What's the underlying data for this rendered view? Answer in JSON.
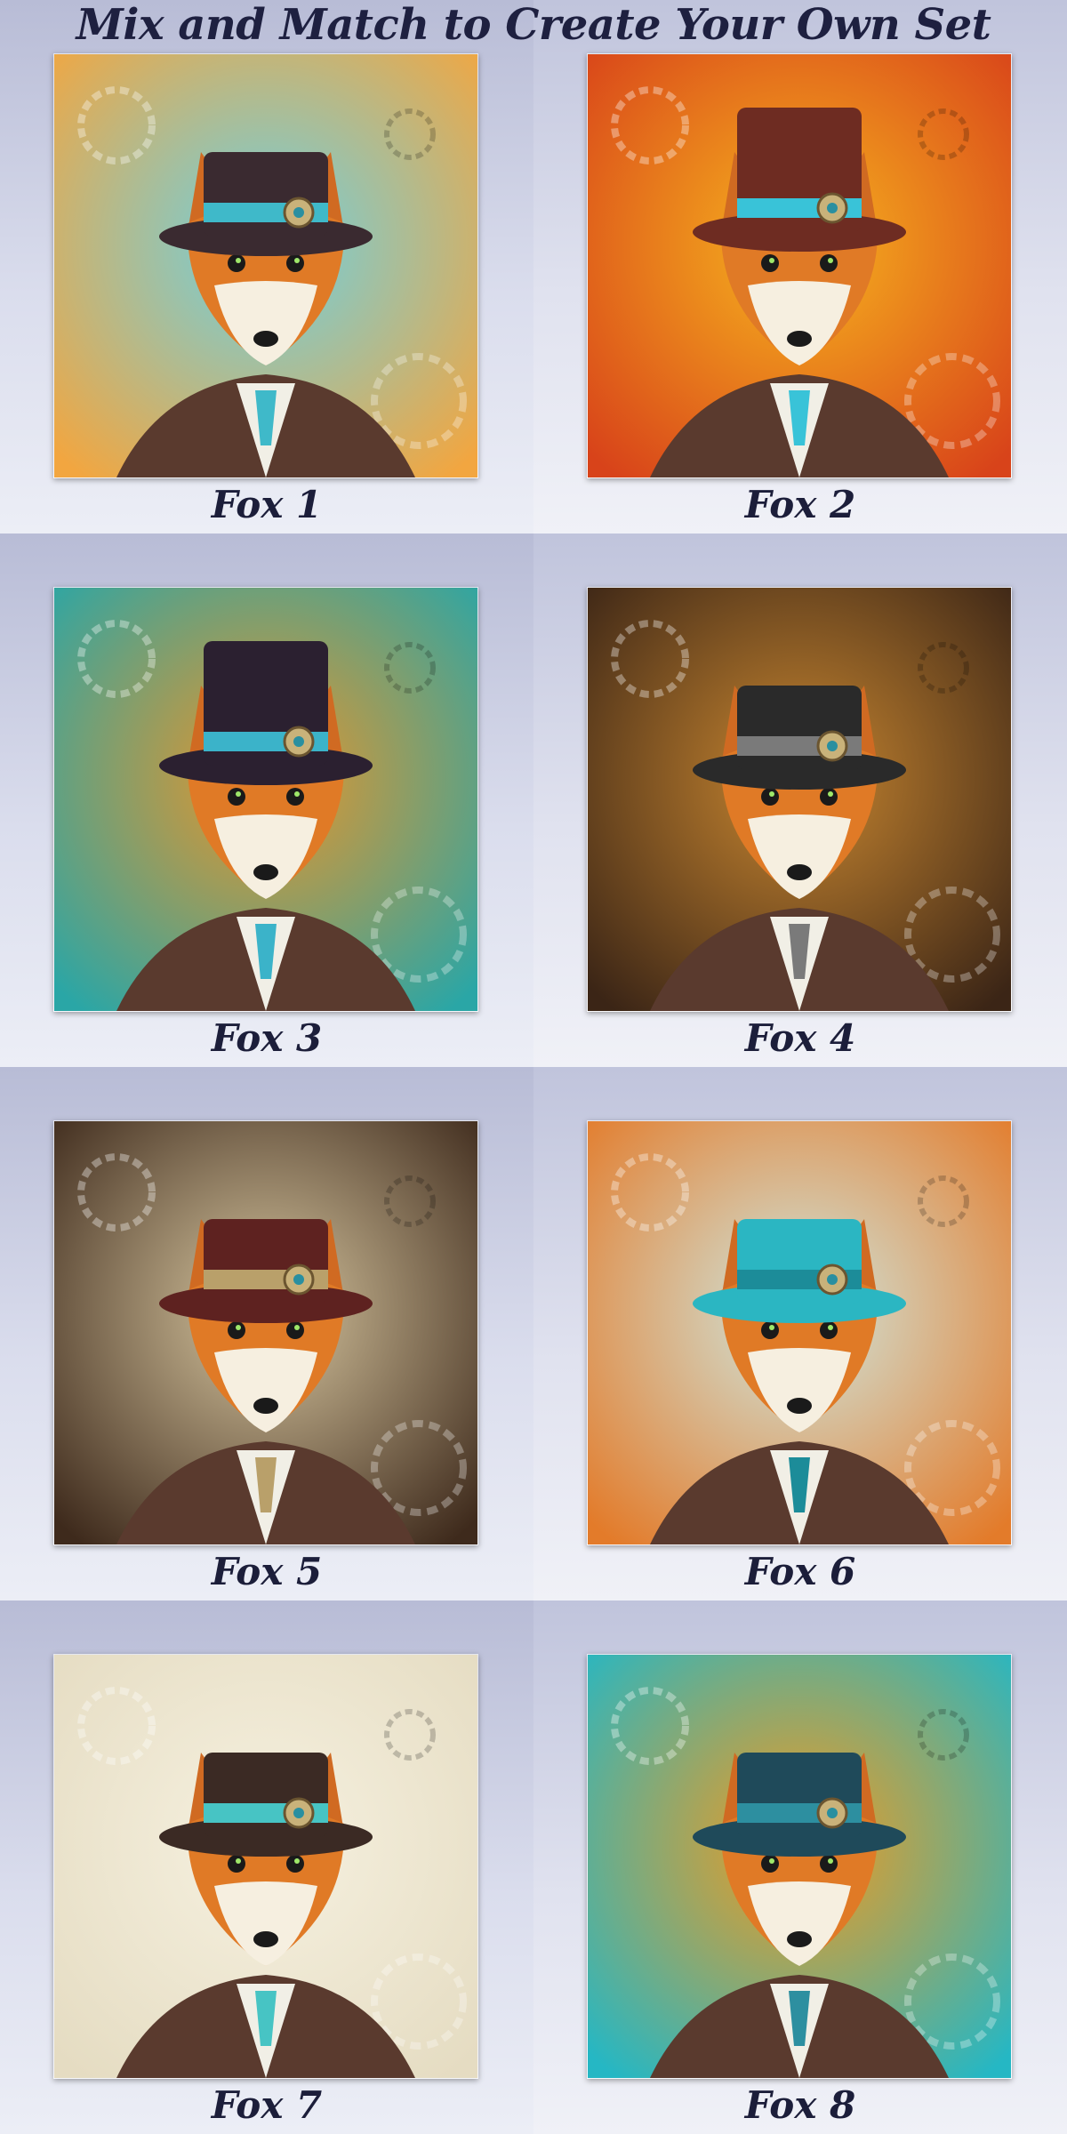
{
  "title": "Mix and Match to Create Your Own Set",
  "items": [
    {
      "label": "Fox 1",
      "icon": "steampunk-fox-goggles-hat-icon",
      "bg1": "#6fd0e0",
      "bg2": "#f2a640",
      "hat": "#3a2a30",
      "band": "#3fb9c9"
    },
    {
      "label": "Fox 2",
      "icon": "steampunk-fox-tophat-icon",
      "bg1": "#f7b51e",
      "bg2": "#d8431a",
      "hat": "#6e2c22",
      "band": "#39c3d8"
    },
    {
      "label": "Fox 3",
      "icon": "steampunk-fox-tall-tophat-icon",
      "bg1": "#e8952a",
      "bg2": "#2aa6a6",
      "hat": "#2b2030",
      "band": "#3bb3c9"
    },
    {
      "label": "Fox 4",
      "icon": "steampunk-fox-bowler-icon",
      "bg1": "#c98730",
      "bg2": "#3b2516",
      "hat": "#2a2a2a",
      "band": "#7a7a7a"
    },
    {
      "label": "Fox 5",
      "icon": "steampunk-fox-feather-hat-icon",
      "bg1": "#d8c7a0",
      "bg2": "#3e2a1c",
      "hat": "#5e2220",
      "band": "#b9a06a"
    },
    {
      "label": "Fox 6",
      "icon": "steampunk-fox-teal-tophat-icon",
      "bg1": "#cfe6de",
      "bg2": "#e37b2a",
      "hat": "#2bb6c2",
      "band": "#1c8c99"
    },
    {
      "label": "Fox 7",
      "icon": "steampunk-fox-gear-hat-icon",
      "bg1": "#f6f1e0",
      "bg2": "#e5dcc2",
      "hat": "#3b2a24",
      "band": "#47c4c4"
    },
    {
      "label": "Fox 8",
      "icon": "steampunk-fox-goggles-icon",
      "bg1": "#f29a1e",
      "bg2": "#25b7c4",
      "hat": "#1f4a5a",
      "band": "#2d8fa0"
    }
  ]
}
